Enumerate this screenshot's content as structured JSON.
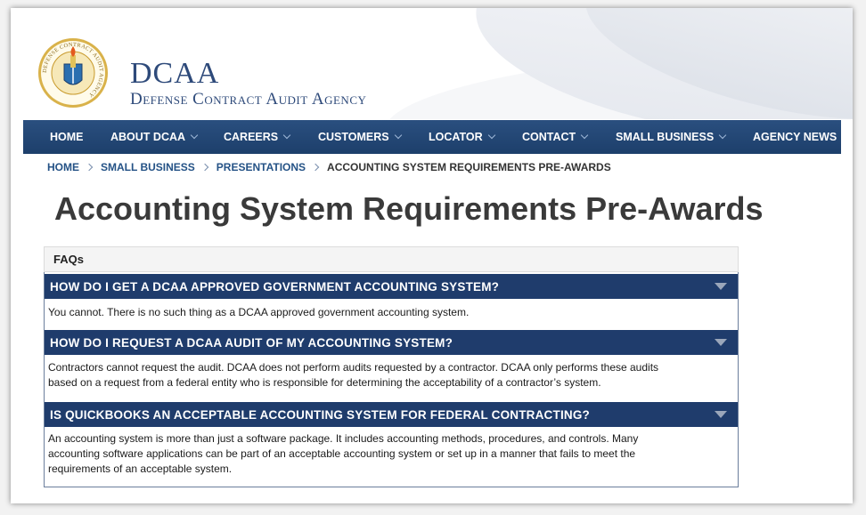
{
  "site": {
    "title": "DCAA",
    "subtitle": "Defense Contract Audit Agency",
    "seal_text": "DEFENSE CONTRACT AUDIT AGENCY"
  },
  "nav": {
    "items": [
      {
        "label": "HOME",
        "has_dropdown": false
      },
      {
        "label": "ABOUT DCAA",
        "has_dropdown": true
      },
      {
        "label": "CAREERS",
        "has_dropdown": true
      },
      {
        "label": "CUSTOMERS",
        "has_dropdown": true
      },
      {
        "label": "LOCATOR",
        "has_dropdown": true
      },
      {
        "label": "CONTACT",
        "has_dropdown": true
      },
      {
        "label": "SMALL BUSINESS",
        "has_dropdown": true
      },
      {
        "label": "AGENCY NEWS",
        "has_dropdown": false
      }
    ]
  },
  "breadcrumb": {
    "items": [
      "HOME",
      "SMALL BUSINESS",
      "PRESENTATIONS"
    ],
    "current": "ACCOUNTING SYSTEM REQUIREMENTS PRE-AWARDS"
  },
  "page": {
    "title": "Accounting System Requirements Pre-Awards"
  },
  "faq": {
    "header": "FAQs",
    "items": [
      {
        "question": "HOW DO I GET A DCAA APPROVED GOVERNMENT ACCOUNTING SYSTEM?",
        "answer_lines": [
          "You cannot.  There is no such thing as a DCAA approved government accounting system."
        ]
      },
      {
        "question": "HOW DO I REQUEST A DCAA AUDIT OF MY ACCOUNTING SYSTEM?",
        "answer_lines": [
          "Contractors cannot request the audit.  DCAA does not perform audits requested by a contractor. DCAA only performs these audits",
          "based on a request from a federal entity who is responsible for determining the acceptability of a contractor’s system."
        ]
      },
      {
        "question": "IS QUICKBOOKS AN ACCEPTABLE ACCOUNTING SYSTEM FOR FEDERAL CONTRACTING?",
        "answer_lines": [
          "An accounting system is more than just a software package.  It includes accounting methods, procedures, and controls.  Many",
          "accounting software applications can be part of an acceptable accounting system or set up in a manner that fails to meet the",
          "requirements of an acceptable system."
        ]
      }
    ]
  },
  "colors": {
    "nav_bg": "#1d3f6b",
    "question_bg": "#1f3c6c",
    "brand_text": "#2e4a7a",
    "link": "#245286"
  }
}
